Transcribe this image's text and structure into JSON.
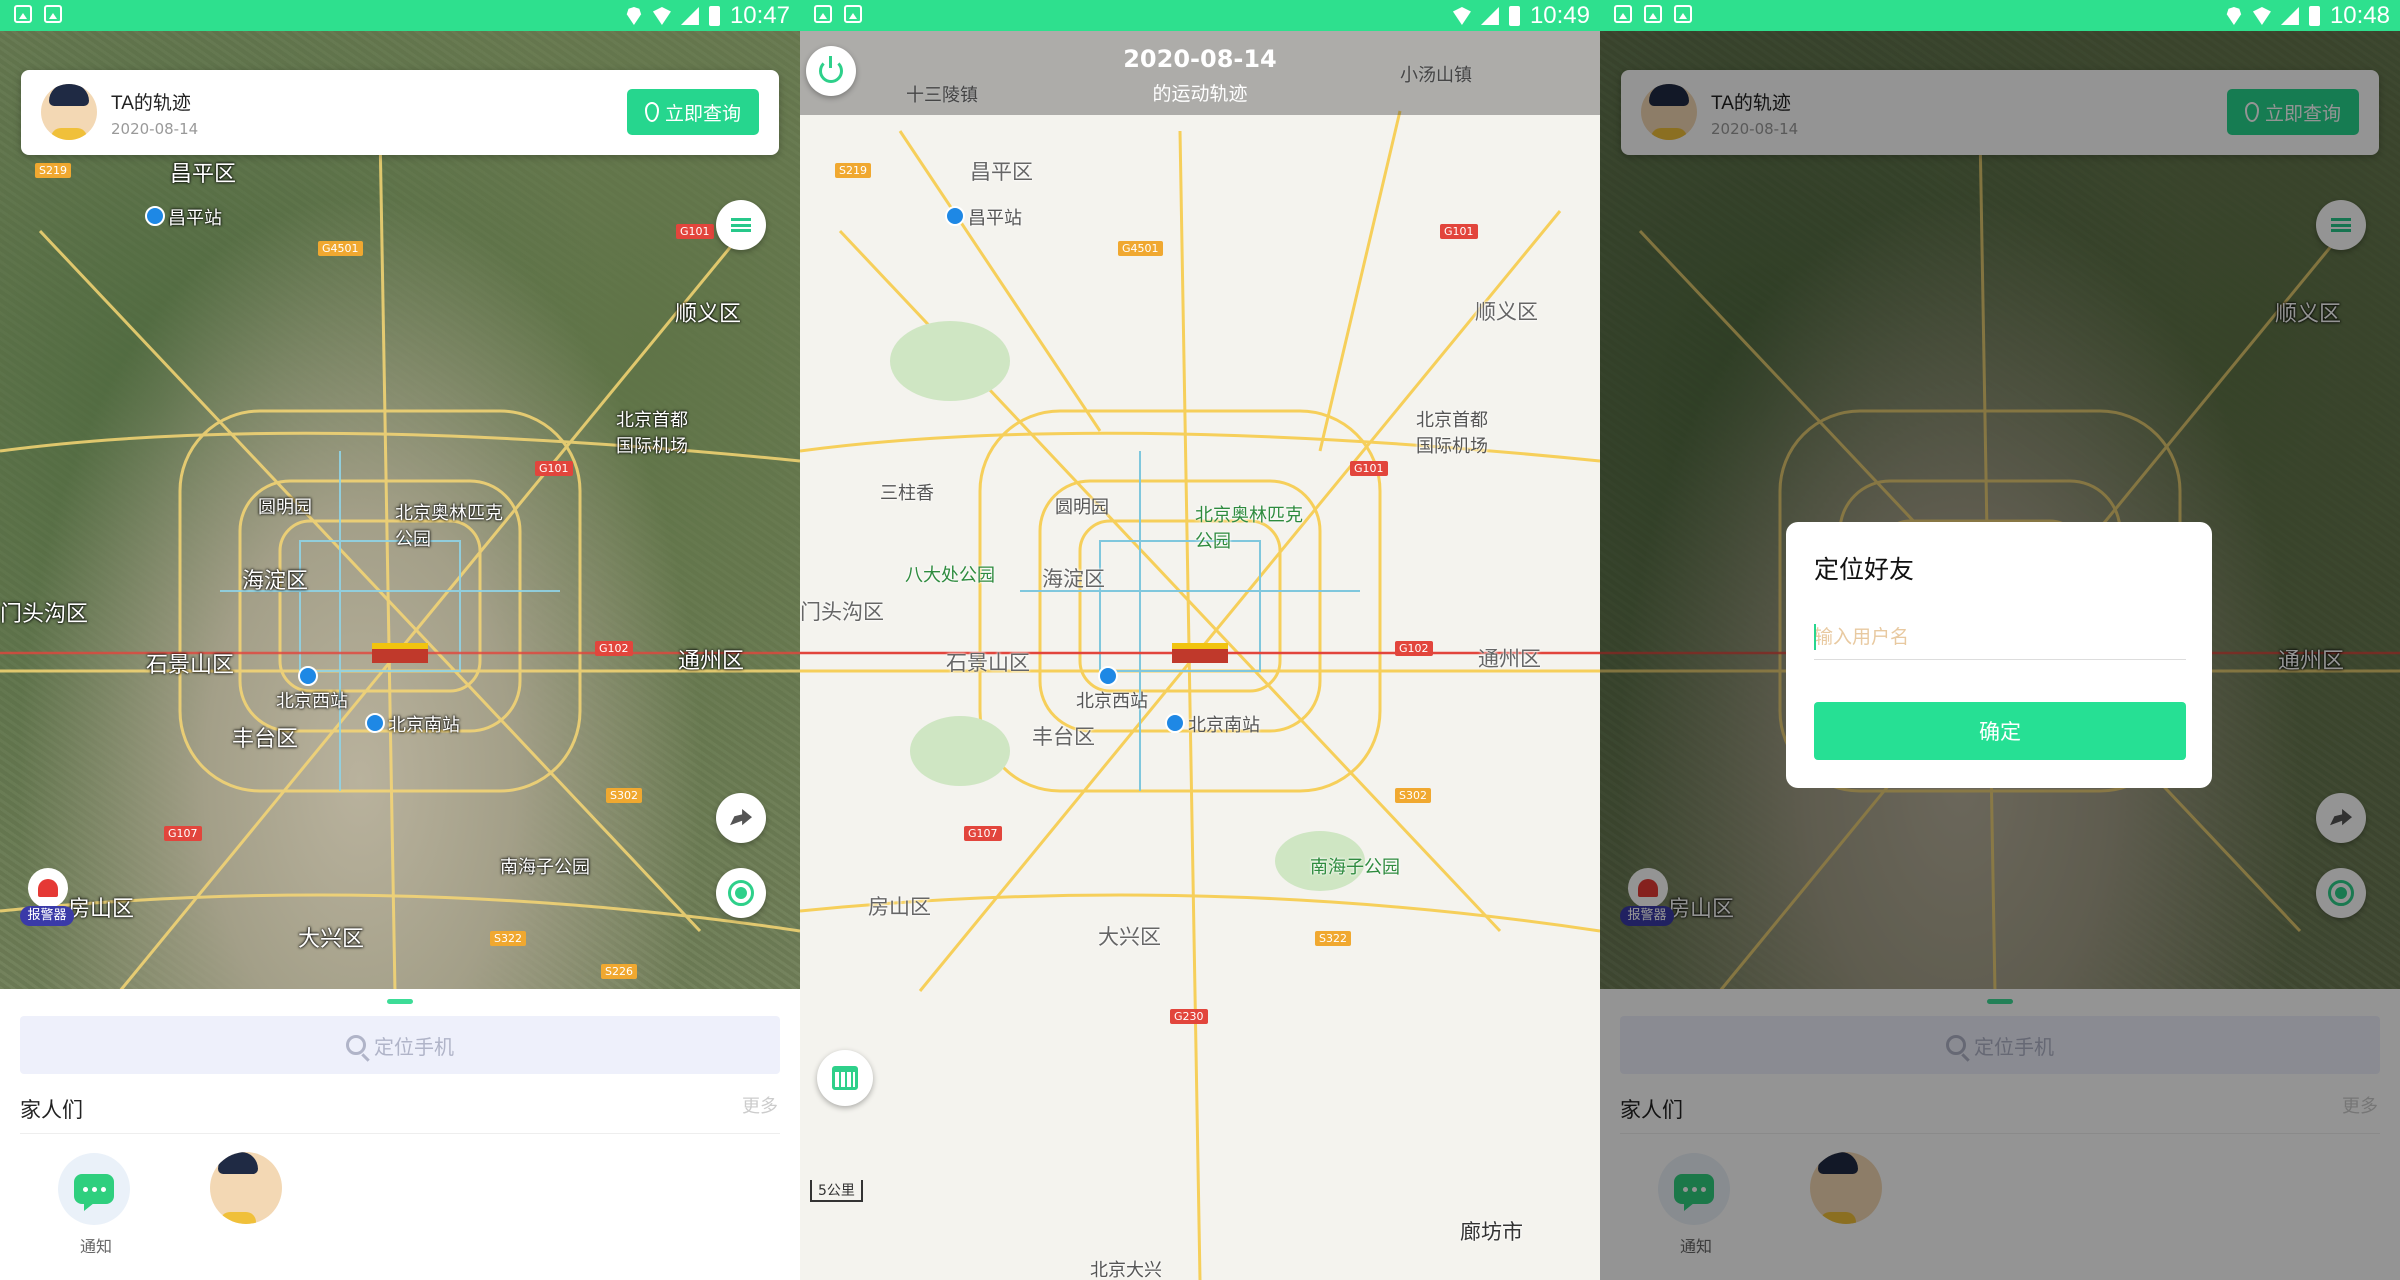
{
  "screens": [
    {
      "status_time": "10:47",
      "card": {
        "title": "TA的轨迹",
        "date": "2020-08-14",
        "query_label": "立即查询"
      },
      "alarm_label": "报警器",
      "sheet": {
        "search_placeholder": "定位手机",
        "family_title": "家人们",
        "more_label": "更多",
        "notice_label": "通知"
      }
    },
    {
      "status_time": "10:49",
      "header": {
        "date": "2020-08-14",
        "subtitle": "的运动轨迹"
      },
      "scale_label": "5公里"
    },
    {
      "status_time": "10:48",
      "card": {
        "title": "TA的轨迹",
        "date": "2020-08-14",
        "query_label": "立即查询"
      },
      "alarm_label": "报警器",
      "sheet": {
        "search_placeholder": "定位手机",
        "family_title": "家人们",
        "more_label": "更多",
        "notice_label": "通知"
      },
      "dialog": {
        "title": "定位好友",
        "input_placeholder": "输入用户名",
        "confirm_label": "确定"
      }
    }
  ],
  "map_labels": {
    "changping": "昌平区",
    "changping_station": "昌平站",
    "shunyi": "顺义区",
    "airport": "北京首都国际机场",
    "haidian": "海淀区",
    "shijingshan": "石景山区",
    "mentougou": "门头沟区",
    "tongzhou": "通州区",
    "fengtai": "丰台区",
    "fangshan": "房山区",
    "daxing": "大兴区",
    "west_station": "北京西站",
    "south_station": "北京南站",
    "olympic": "北京奥林匹克公园",
    "yuanmingyuan": "圆明园",
    "nanhaizi": "南海子公园",
    "langfang": "廊坊市",
    "badachu": "八大处公园",
    "shisanling": "十三陵镇",
    "xiaotangshan": "小汤山镇",
    "daxing_airport": "北京大兴",
    "sanjiadian": "三柱香"
  },
  "colors": {
    "accent": "#26d68e",
    "status_bar": "#2ee08e",
    "alarm_badge": "#3a3aa8"
  },
  "icons": [
    "gallery-icon",
    "location-icon",
    "wifi-icon",
    "signal-icon",
    "battery-icon",
    "pin-icon",
    "menu-icon",
    "share-icon",
    "locate-target-icon",
    "alarm-icon",
    "search-icon",
    "chat-icon",
    "power-icon",
    "calendar-icon"
  ]
}
